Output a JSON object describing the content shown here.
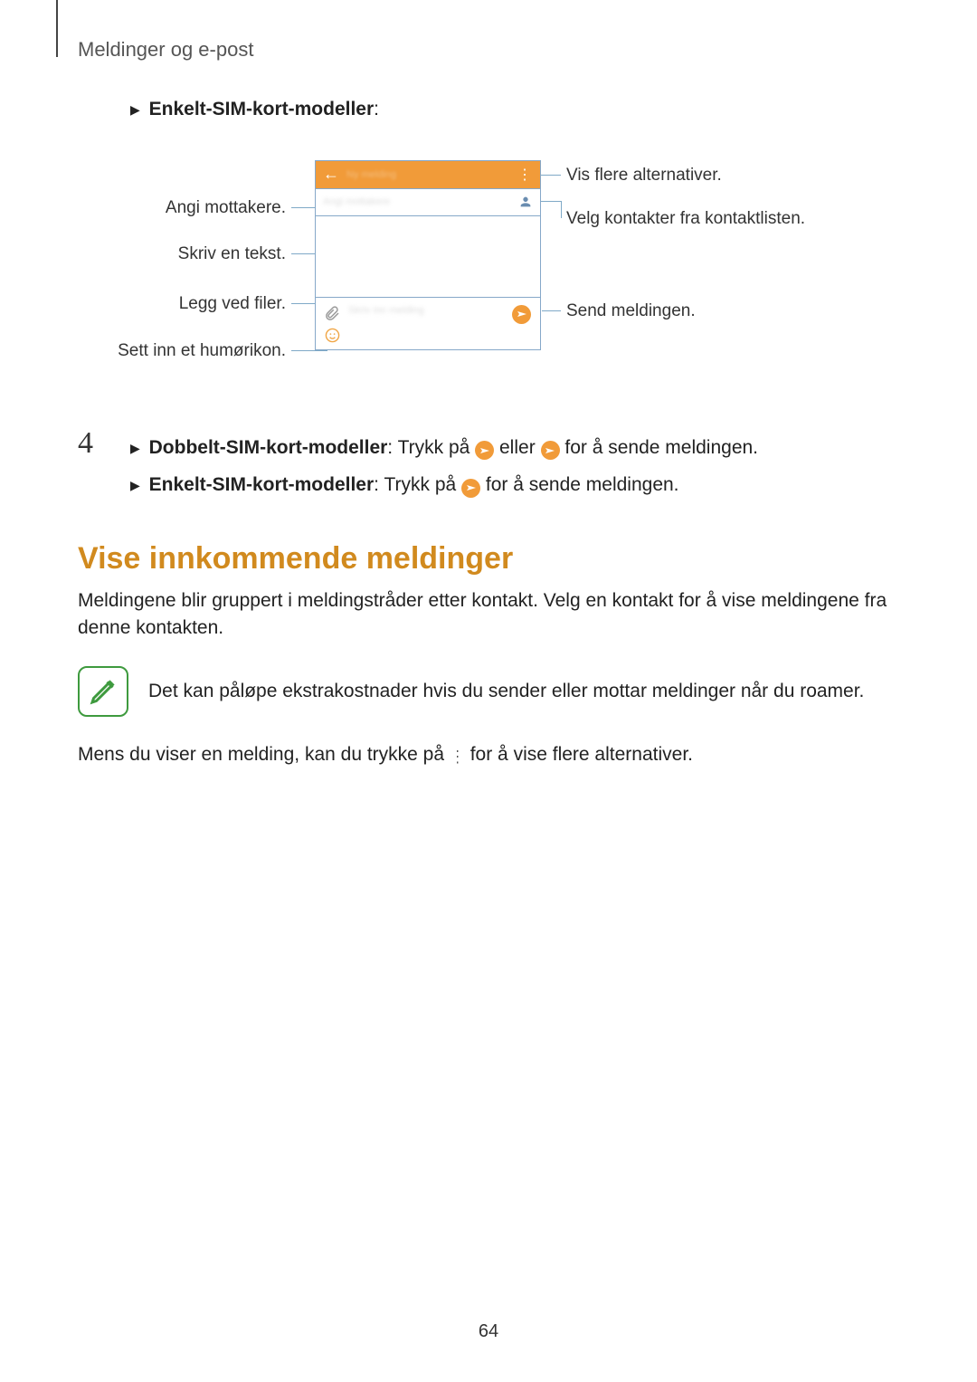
{
  "header": "Meldinger og e-post",
  "first_bullet": {
    "label": "Enkelt-SIM-kort-modeller",
    "suffix": ":"
  },
  "diagram": {
    "left": {
      "recipients": "Angi mottakere.",
      "write": "Skriv en tekst.",
      "attach": "Legg ved filer.",
      "emoji": "Sett inn et humørikon."
    },
    "right": {
      "more": "Vis flere alternativer.",
      "contacts": "Velg kontakter fra kontaktlisten.",
      "send": "Send meldingen."
    }
  },
  "step4": {
    "num": "4",
    "line1_prefix": "Dobbelt-SIM-kort-modeller",
    "line1_mid1": ": Trykk på ",
    "line1_mid2": " eller ",
    "line1_end": " for å sende meldingen.",
    "line2_prefix": "Enkelt-SIM-kort-modeller",
    "line2_mid": ": Trykk på ",
    "line2_end": " for å sende meldingen."
  },
  "section_title": "Vise innkommende meldinger",
  "section_para": "Meldingene blir gruppert i meldingstråder etter kontakt. Velg en kontakt for å vise meldingene fra denne kontakten.",
  "note": "Det kan påløpe ekstrakostnader hvis du sender eller mottar meldinger når du roamer.",
  "final_para_a": "Mens du viser en melding, kan du trykke på ",
  "final_para_b": " for å vise flere alternativer.",
  "page_number": "64"
}
